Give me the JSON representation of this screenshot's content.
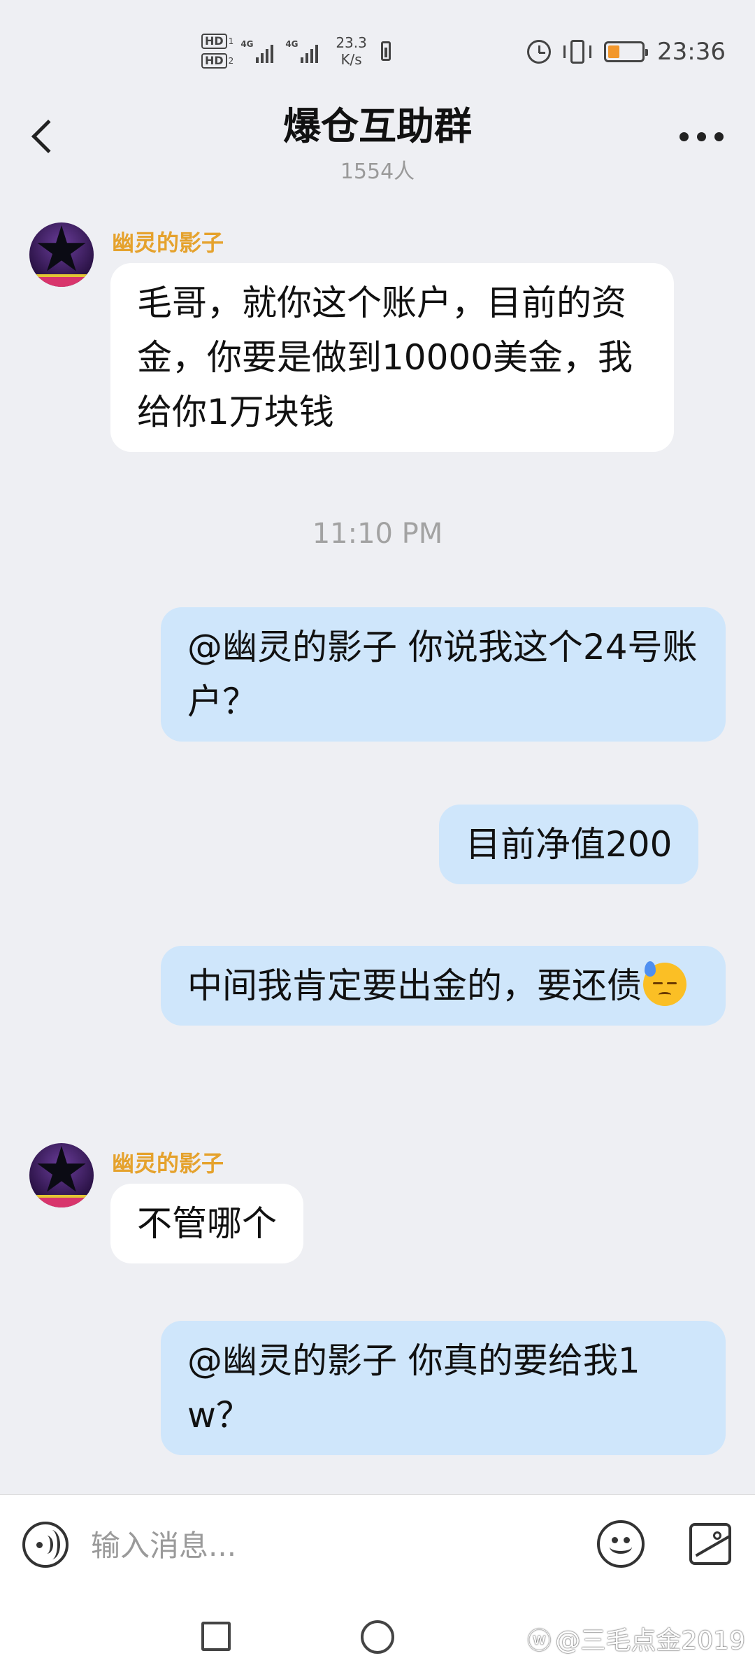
{
  "status_bar": {
    "hd1": "HD",
    "hd1_num": "1",
    "hd2": "HD",
    "hd2_num": "2",
    "net1": "4G",
    "net2": "4G",
    "speed_value": "23.3",
    "speed_unit": "K/s",
    "battery_level_percent": 25,
    "battery_color": "#f2972c",
    "time": "23:36",
    "icons": [
      "alarm-icon",
      "vibrate-icon",
      "battery-icon"
    ]
  },
  "header": {
    "back_icon": "chevron-left-icon",
    "title": "爆仓互助群",
    "member_count": "1554人",
    "more_icon": "more-dots-icon"
  },
  "messages": [
    {
      "side": "in",
      "sender": "幽灵的影子",
      "text": "毛哥，就你这个账户，目前的资金，你要是做到10000美金，我给你1万块钱"
    },
    {
      "timestamp": "11:10 PM"
    },
    {
      "side": "out",
      "text": "@幽灵的影子 你说我这个24号账户？"
    },
    {
      "side": "out",
      "text": "目前净值200"
    },
    {
      "side": "out",
      "text": "中间我肯定要出金的，要还债",
      "emoji": "sweat-face-icon"
    },
    {
      "side": "in",
      "sender": "幽灵的影子",
      "text": "不管哪个"
    },
    {
      "side": "out",
      "text": "@幽灵的影子 你真的要给我1w？"
    }
  ],
  "input_bar": {
    "voice_icon": "voice-icon",
    "placeholder": "输入消息...",
    "emoji_icon": "emoji-icon",
    "image_icon": "image-icon"
  },
  "nav_bar": {
    "icons": [
      "recent-apps-icon",
      "home-icon"
    ],
    "watermark": "@三毛点金2019"
  },
  "colors": {
    "background": "#eeeff3",
    "incoming_bubble": "#ffffff",
    "outgoing_bubble": "#cfe6fb",
    "sender_name": "#e5a22d"
  }
}
